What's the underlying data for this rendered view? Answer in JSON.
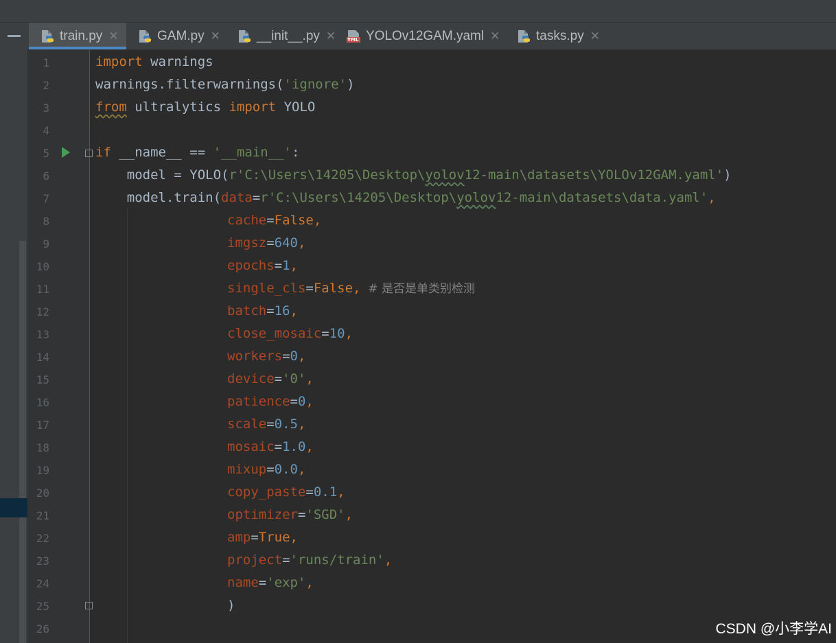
{
  "tabs": [
    {
      "label": "train.py",
      "icon": "python-file-icon",
      "active": true
    },
    {
      "label": "GAM.py",
      "icon": "python-file-icon",
      "active": false
    },
    {
      "label": "__init__.py",
      "icon": "python-file-icon",
      "active": false
    },
    {
      "label": "YOLOv12GAM.yaml",
      "icon": "yaml-file-icon",
      "icon_text": "YML",
      "active": false
    },
    {
      "label": "tasks.py",
      "icon": "python-file-icon",
      "active": false
    }
  ],
  "close_glyph": "✕",
  "line_numbers": [
    "1",
    "2",
    "3",
    "4",
    "5",
    "6",
    "7",
    "8",
    "9",
    "10",
    "11",
    "12",
    "13",
    "14",
    "15",
    "16",
    "17",
    "18",
    "19",
    "20",
    "21",
    "22",
    "23",
    "24",
    "25",
    "26"
  ],
  "code": {
    "l1": {
      "kw": "import",
      "rest": " warnings"
    },
    "l2": {
      "a": "warnings.filterwarnings(",
      "s": "'ignore'",
      "b": ")"
    },
    "l3": {
      "kw1": "from",
      "mod": " ultralytics ",
      "kw2": "import",
      "rest": " YOLO"
    },
    "l5": {
      "kw": "if",
      "a": " __name__ == ",
      "s": "'__main__'",
      "b": ":"
    },
    "l6": {
      "a": "    model = YOLO(",
      "s1": "r'C:\\Users\\14205\\Desktop\\",
      "s2": "yolov",
      "s3": "12-main\\datasets\\YOLOv12GAM.yaml'",
      "b": ")"
    },
    "l7": {
      "a": "    model.train(",
      "p": "data",
      "eq": "=",
      "s1": "r'C:\\Users\\14205\\Desktop\\",
      "s2": "yolov",
      "s3": "12-main\\datasets\\data.yaml'",
      "b": ","
    },
    "l8": {
      "p": "cache",
      "v": "False"
    },
    "l9": {
      "p": "imgsz",
      "v": "640"
    },
    "l10": {
      "p": "epochs",
      "v": "1"
    },
    "l11": {
      "p": "single_cls",
      "v": "False",
      "c": "  # 是否是单类别检测"
    },
    "l12": {
      "p": "batch",
      "v": "16"
    },
    "l13": {
      "p": "close_mosaic",
      "v": "10"
    },
    "l14": {
      "p": "workers",
      "v": "0"
    },
    "l15": {
      "p": "device",
      "v": "'0'"
    },
    "l16": {
      "p": "patience",
      "v": "0"
    },
    "l17": {
      "p": "scale",
      "v": "0.5"
    },
    "l18": {
      "p": "mosaic",
      "v": "1.0"
    },
    "l19": {
      "p": "mixup",
      "v": "0.0"
    },
    "l20": {
      "p": "copy_paste",
      "v": "0.1"
    },
    "l21": {
      "p": "optimizer",
      "v": "'SGD'"
    },
    "l22": {
      "p": "amp",
      "v": "True"
    },
    "l23": {
      "p": "project",
      "v": "'runs/train'"
    },
    "l24": {
      "p": "name",
      "v": "'exp'"
    },
    "l25": {
      "close": ")"
    }
  },
  "eq": "=",
  "comma": ",",
  "watermark": "CSDN @小李学AI",
  "colors": {
    "keyword": "#cc7832",
    "string": "#6a8759",
    "number": "#6897bb",
    "param": "#aa4926",
    "comment": "#808080",
    "text": "#a9b7c6",
    "run": "#499c54",
    "tab_underline": "#4a88c7"
  }
}
